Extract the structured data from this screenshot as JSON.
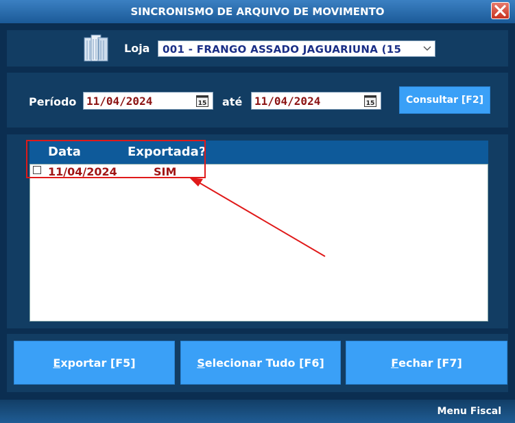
{
  "window": {
    "title": "SINCRONISMO DE ARQUIVO DE MOVIMENTO",
    "close_icon": "close-icon"
  },
  "store": {
    "icon": "server-icon",
    "label": "Loja",
    "selected_value": "001 - FRANGO ASSADO JAGUARIUNA (15"
  },
  "period": {
    "label": "Período",
    "start_date": "11/04/2024",
    "until_label": "até",
    "end_date": "11/04/2024",
    "calendar_icon": "calendar-icon",
    "calendar_day": "15",
    "consult_button": "Consultar [F2]"
  },
  "list": {
    "columns": [
      "Data",
      "Exportada?"
    ],
    "rows": [
      {
        "date": "11/04/2024",
        "exported": "SIM",
        "checked": false
      }
    ]
  },
  "actions": {
    "export": {
      "hotkey_letter": "E",
      "rest": "xportar [F5]"
    },
    "select_all": {
      "hotkey_letter": "S",
      "rest": "elecionar Tudo [F6]"
    },
    "close": {
      "hotkey_letter": "F",
      "rest": "echar [F7]"
    }
  },
  "status_bar": {
    "text": "Menu Fiscal"
  },
  "colors": {
    "title_bar": "#2a6db0",
    "background": "#0b2e51",
    "panel": "#123d63",
    "button": "#3aa0f7",
    "date_text": "#8c1313",
    "store_text": "#1a2e86",
    "highlight": "#e01919"
  }
}
